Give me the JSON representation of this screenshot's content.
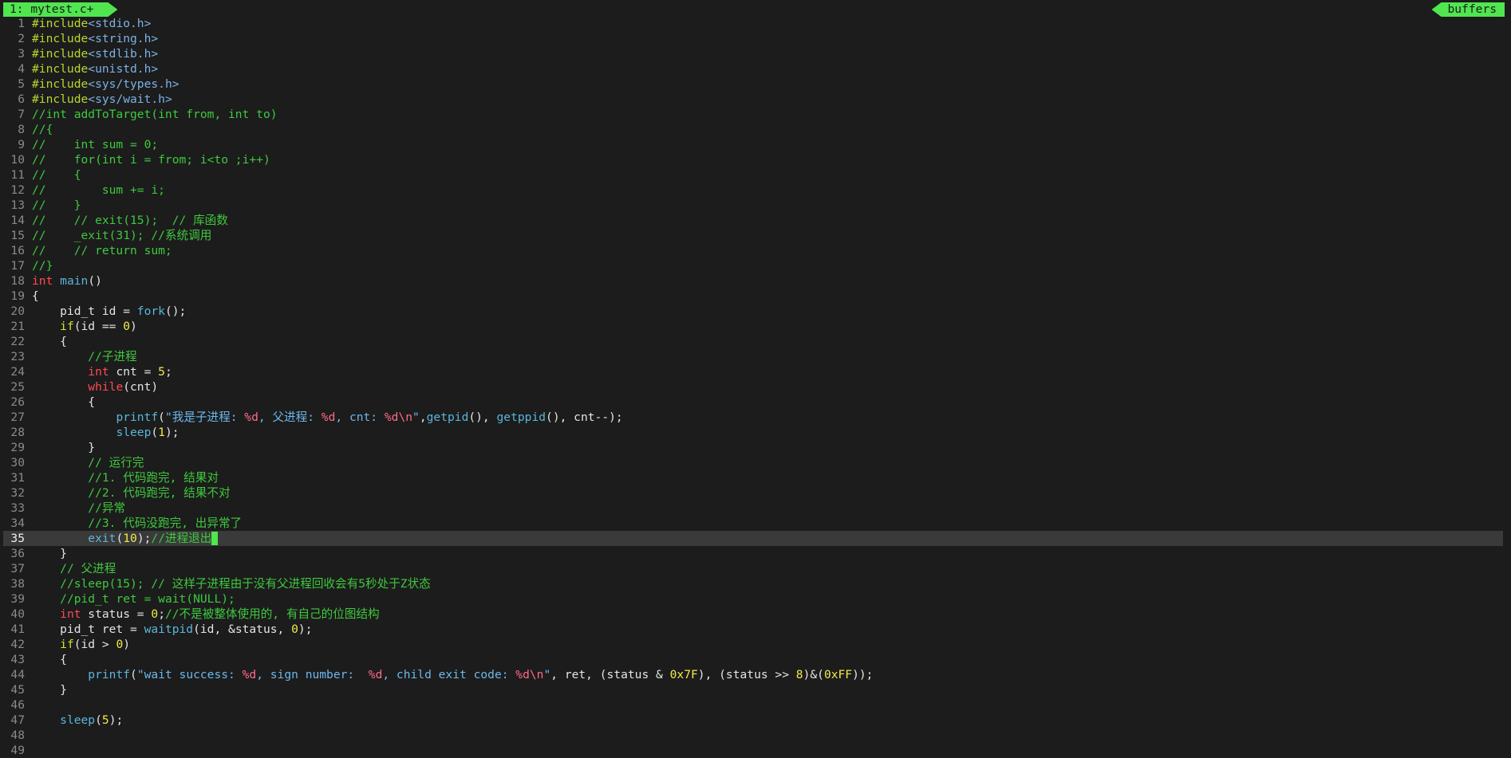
{
  "tabline": {
    "active_tab": "1: mytest.c+",
    "buffers_label": "buffers"
  },
  "colors": {
    "background": "#1c1c1c",
    "tab_green": "#4fe64f",
    "cursorline": "#3a3a3a",
    "comment": "#3ec93e",
    "type": "#ff4a52",
    "function": "#5ab6dc",
    "number": "#f2ea4a"
  },
  "editor": {
    "cursor_line": 35,
    "lines": [
      {
        "n": "1",
        "s": [
          [
            "preproc",
            "#include"
          ],
          [
            "inc",
            "<stdio.h>"
          ]
        ]
      },
      {
        "n": "2",
        "s": [
          [
            "preproc",
            "#include"
          ],
          [
            "inc",
            "<string.h>"
          ]
        ]
      },
      {
        "n": "3",
        "s": [
          [
            "preproc",
            "#include"
          ],
          [
            "inc",
            "<stdlib.h>"
          ]
        ]
      },
      {
        "n": "4",
        "s": [
          [
            "preproc",
            "#include"
          ],
          [
            "inc",
            "<unistd.h>"
          ]
        ]
      },
      {
        "n": "5",
        "s": [
          [
            "preproc",
            "#include"
          ],
          [
            "inc",
            "<sys/types.h>"
          ]
        ]
      },
      {
        "n": "6",
        "s": [
          [
            "preproc",
            "#include"
          ],
          [
            "inc",
            "<sys/wait.h>"
          ]
        ]
      },
      {
        "n": "7",
        "s": [
          [
            "comment",
            "//int addToTarget(int from, int to)"
          ]
        ]
      },
      {
        "n": "8",
        "s": [
          [
            "comment",
            "//{"
          ]
        ]
      },
      {
        "n": "9",
        "s": [
          [
            "comment",
            "//    int sum = 0;"
          ]
        ]
      },
      {
        "n": "10",
        "s": [
          [
            "comment",
            "//    for(int i = from; i<to ;i++)"
          ]
        ]
      },
      {
        "n": "11",
        "s": [
          [
            "comment",
            "//    {"
          ]
        ]
      },
      {
        "n": "12",
        "s": [
          [
            "comment",
            "//        sum += i;"
          ]
        ]
      },
      {
        "n": "13",
        "s": [
          [
            "comment",
            "//    }"
          ]
        ]
      },
      {
        "n": "14",
        "s": [
          [
            "comment",
            "//    // exit(15);  // 库函数"
          ]
        ]
      },
      {
        "n": "15",
        "s": [
          [
            "comment",
            "//    _exit(31); //系统调用"
          ]
        ]
      },
      {
        "n": "16",
        "s": [
          [
            "comment",
            "//    // return sum;"
          ]
        ]
      },
      {
        "n": "17",
        "s": [
          [
            "comment",
            "//}"
          ]
        ]
      },
      {
        "n": "18",
        "s": [
          [
            "type",
            "int"
          ],
          [
            "plain",
            " "
          ],
          [
            "func",
            "main"
          ],
          [
            "plain",
            "()"
          ]
        ]
      },
      {
        "n": "19",
        "s": [
          [
            "plain",
            "{"
          ]
        ]
      },
      {
        "n": "20",
        "s": [
          [
            "plain",
            "    pid_t id = "
          ],
          [
            "func",
            "fork"
          ],
          [
            "plain",
            "();"
          ]
        ]
      },
      {
        "n": "21",
        "s": [
          [
            "plain",
            "    "
          ],
          [
            "kw",
            "if"
          ],
          [
            "plain",
            "(id == "
          ],
          [
            "num",
            "0"
          ],
          [
            "plain",
            ")"
          ]
        ]
      },
      {
        "n": "22",
        "s": [
          [
            "plain",
            "    {"
          ]
        ]
      },
      {
        "n": "23",
        "s": [
          [
            "plain",
            "        "
          ],
          [
            "comment",
            "//子进程"
          ]
        ]
      },
      {
        "n": "24",
        "s": [
          [
            "plain",
            "        "
          ],
          [
            "type",
            "int"
          ],
          [
            "plain",
            " cnt = "
          ],
          [
            "num",
            "5"
          ],
          [
            "plain",
            ";"
          ]
        ]
      },
      {
        "n": "25",
        "s": [
          [
            "plain",
            "        "
          ],
          [
            "kwred",
            "while"
          ],
          [
            "plain",
            "(cnt)"
          ]
        ]
      },
      {
        "n": "26",
        "s": [
          [
            "plain",
            "        {"
          ]
        ]
      },
      {
        "n": "27",
        "s": [
          [
            "plain",
            "            "
          ],
          [
            "func",
            "printf"
          ],
          [
            "plain",
            "("
          ],
          [
            "str",
            "\"我是子进程: "
          ],
          [
            "fmt",
            "%d"
          ],
          [
            "str",
            ", 父进程: "
          ],
          [
            "fmt",
            "%d"
          ],
          [
            "str",
            ", cnt: "
          ],
          [
            "fmt",
            "%d\\n"
          ],
          [
            "str",
            "\""
          ],
          [
            "plain",
            ","
          ],
          [
            "func",
            "getpid"
          ],
          [
            "plain",
            "(), "
          ],
          [
            "func",
            "getppid"
          ],
          [
            "plain",
            "(), cnt--);"
          ]
        ]
      },
      {
        "n": "28",
        "s": [
          [
            "plain",
            "            "
          ],
          [
            "func",
            "sleep"
          ],
          [
            "plain",
            "("
          ],
          [
            "num",
            "1"
          ],
          [
            "plain",
            ");"
          ]
        ]
      },
      {
        "n": "29",
        "s": [
          [
            "plain",
            "        }"
          ]
        ]
      },
      {
        "n": "30",
        "s": [
          [
            "plain",
            "        "
          ],
          [
            "comment",
            "// 运行完"
          ]
        ]
      },
      {
        "n": "31",
        "s": [
          [
            "plain",
            "        "
          ],
          [
            "comment",
            "//1. 代码跑完, 结果对"
          ]
        ]
      },
      {
        "n": "32",
        "s": [
          [
            "plain",
            "        "
          ],
          [
            "comment",
            "//2. 代码跑完, 结果不对"
          ]
        ]
      },
      {
        "n": "33",
        "s": [
          [
            "plain",
            "        "
          ],
          [
            "comment",
            "//异常"
          ]
        ]
      },
      {
        "n": "34",
        "s": [
          [
            "plain",
            "        "
          ],
          [
            "comment",
            "//3. 代码没跑完, 出异常了"
          ]
        ]
      },
      {
        "n": "35",
        "s": [
          [
            "plain",
            "        "
          ],
          [
            "func",
            "exit"
          ],
          [
            "plain",
            "("
          ],
          [
            "num",
            "10"
          ],
          [
            "plain",
            ");"
          ],
          [
            "comment",
            "//进程退出"
          ]
        ],
        "cursor": true
      },
      {
        "n": "36",
        "s": [
          [
            "plain",
            "    }"
          ]
        ]
      },
      {
        "n": "37",
        "s": [
          [
            "plain",
            "    "
          ],
          [
            "comment",
            "// 父进程"
          ]
        ]
      },
      {
        "n": "38",
        "s": [
          [
            "plain",
            "    "
          ],
          [
            "comment",
            "//sleep(15); // 这样子进程由于没有父进程回收会有5秒处于Z状态"
          ]
        ]
      },
      {
        "n": "39",
        "s": [
          [
            "plain",
            "    "
          ],
          [
            "comment",
            "//pid_t ret = wait(NULL);"
          ]
        ]
      },
      {
        "n": "40",
        "s": [
          [
            "plain",
            "    "
          ],
          [
            "type",
            "int"
          ],
          [
            "plain",
            " status = "
          ],
          [
            "num",
            "0"
          ],
          [
            "plain",
            ";"
          ],
          [
            "comment",
            "//不是被整体使用的, 有自己的位图结构"
          ]
        ]
      },
      {
        "n": "41",
        "s": [
          [
            "plain",
            "    pid_t ret = "
          ],
          [
            "func",
            "waitpid"
          ],
          [
            "plain",
            "(id, &status, "
          ],
          [
            "num",
            "0"
          ],
          [
            "plain",
            ");"
          ]
        ]
      },
      {
        "n": "42",
        "s": [
          [
            "plain",
            "    "
          ],
          [
            "kw",
            "if"
          ],
          [
            "plain",
            "(id > "
          ],
          [
            "num",
            "0"
          ],
          [
            "plain",
            ")"
          ]
        ]
      },
      {
        "n": "43",
        "s": [
          [
            "plain",
            "    {"
          ]
        ]
      },
      {
        "n": "44",
        "s": [
          [
            "plain",
            "        "
          ],
          [
            "func",
            "printf"
          ],
          [
            "plain",
            "("
          ],
          [
            "str",
            "\"wait success: "
          ],
          [
            "fmt",
            "%d"
          ],
          [
            "str",
            ", sign number:  "
          ],
          [
            "fmt",
            "%d"
          ],
          [
            "str",
            ", child exit code: "
          ],
          [
            "fmt",
            "%d\\n"
          ],
          [
            "str",
            "\""
          ],
          [
            "plain",
            ", ret, (status & "
          ],
          [
            "num",
            "0x7F"
          ],
          [
            "plain",
            "), (status >> "
          ],
          [
            "num",
            "8"
          ],
          [
            "plain",
            ")&("
          ],
          [
            "num",
            "0xFF"
          ],
          [
            "plain",
            "));"
          ]
        ]
      },
      {
        "n": "45",
        "s": [
          [
            "plain",
            "    }"
          ]
        ]
      },
      {
        "n": "46",
        "s": []
      },
      {
        "n": "47",
        "s": [
          [
            "plain",
            "    "
          ],
          [
            "func",
            "sleep"
          ],
          [
            "plain",
            "("
          ],
          [
            "num",
            "5"
          ],
          [
            "plain",
            ");"
          ]
        ]
      },
      {
        "n": "48",
        "s": []
      },
      {
        "n": "49",
        "s": []
      }
    ]
  }
}
